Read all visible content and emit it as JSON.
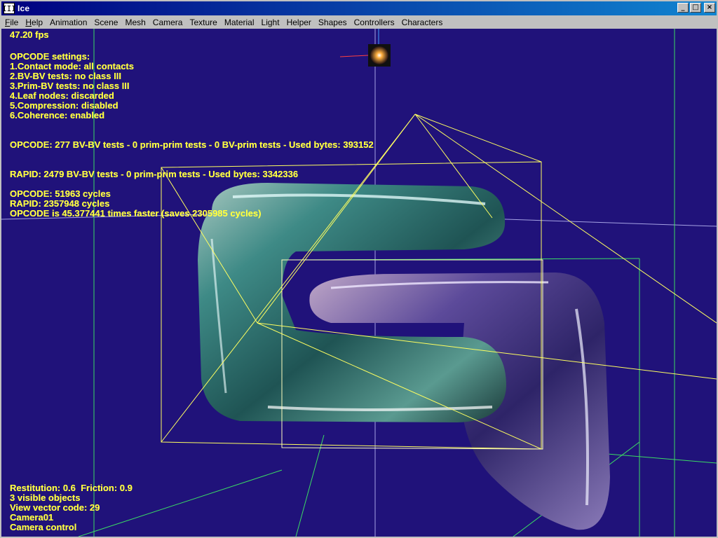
{
  "window": {
    "title": "Ice",
    "app_icon": "III",
    "buttons": {
      "minimize": "_",
      "maximize": "□",
      "close": "×"
    }
  },
  "menu": [
    {
      "label": "File",
      "accel": "F",
      "rest": "ile"
    },
    {
      "label": "Help",
      "accel": "H",
      "rest": "elp"
    },
    {
      "label": "Animation",
      "accel": "",
      "rest": "Animation"
    },
    {
      "label": "Scene",
      "accel": "",
      "rest": "Scene"
    },
    {
      "label": "Mesh",
      "accel": "",
      "rest": "Mesh"
    },
    {
      "label": "Camera",
      "accel": "",
      "rest": "Camera"
    },
    {
      "label": "Texture",
      "accel": "",
      "rest": "Texture"
    },
    {
      "label": "Material",
      "accel": "",
      "rest": "Material"
    },
    {
      "label": "Light",
      "accel": "",
      "rest": "Light"
    },
    {
      "label": "Helper",
      "accel": "",
      "rest": "Helper"
    },
    {
      "label": "Shapes",
      "accel": "",
      "rest": "Shapes"
    },
    {
      "label": "Controllers",
      "accel": "",
      "rest": "Controllers"
    },
    {
      "label": "Characters",
      "accel": "",
      "rest": "Characters"
    }
  ],
  "hud": {
    "fps": "47.20 fps",
    "settings_title": "OPCODE settings:",
    "settings": [
      "1.Contact mode: all contacts",
      "2.BV-BV tests: no class III",
      "3.Prim-BV tests: no class III",
      "4.Leaf nodes: discarded",
      "5.Compression: disabled",
      "6.Coherence: enabled"
    ],
    "opcode_stats": "OPCODE: 277 BV-BV tests - 0 prim-prim tests - 0 BV-prim tests - Used bytes: 393152",
    "rapid_stats": "RAPID: 2479 BV-BV tests - 0 prim-prim tests - Used bytes: 3342336",
    "opcode_cycles": "OPCODE: 51963 cycles",
    "rapid_cycles": "RAPID: 2357948 cycles",
    "speedup": "OPCODE is 45.377441 times faster (saves 2305985 cycles)",
    "bottom": [
      "Restitution: 0.6  Friction: 0.9",
      "3 visible objects",
      "View vector code: 29",
      "Camera01",
      "Camera control"
    ]
  },
  "colors": {
    "background": "#20127a",
    "hud_text": "#ffff40",
    "bbox_yellow": "#ffff60",
    "bbox_green": "#40ff60",
    "grid_white": "#c8c8ff",
    "obj_teal": "#3a8a8a",
    "obj_purple": "#5a4a9a"
  }
}
